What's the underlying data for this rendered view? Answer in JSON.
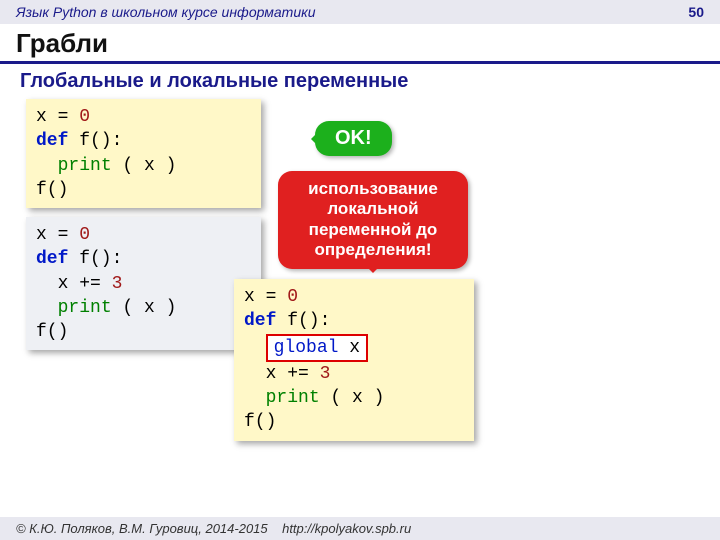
{
  "header": {
    "course": "Язык Python в школьном курсе информатики",
    "page": "50"
  },
  "title": "Грабли",
  "subtitle": "Глобальные и локальные переменные",
  "code1": {
    "l1a": "x = ",
    "l1b": "0",
    "l2a": "def",
    "l2b": " f():",
    "l3a": "  ",
    "l3b": "print",
    "l3c": " ( x )",
    "l4": "f()"
  },
  "code2": {
    "l1a": "x = ",
    "l1b": "0",
    "l2a": "def",
    "l2b": " f():",
    "l3a": "  x += ",
    "l3b": "3",
    "l4a": "  ",
    "l4b": "print",
    "l4c": " ( x )",
    "l5": "f()"
  },
  "code3": {
    "l1a": "x = ",
    "l1b": "0",
    "l2a": "def",
    "l2b": " f():",
    "g1": "global",
    "g2": " x",
    "l4a": "  x += ",
    "l4b": "3",
    "l5a": "  ",
    "l5b": "print",
    "l5c": " ( x )",
    "l6": "f()"
  },
  "ok": "OK!",
  "err": {
    "l1": "использование",
    "l2": "локальной",
    "l3": "переменной до",
    "l4": "определения!"
  },
  "footer": {
    "copyright": "© К.Ю. Поляков, В.М. Гуровиц, 2014-2015",
    "url": "http://kpolyakov.spb.ru"
  }
}
